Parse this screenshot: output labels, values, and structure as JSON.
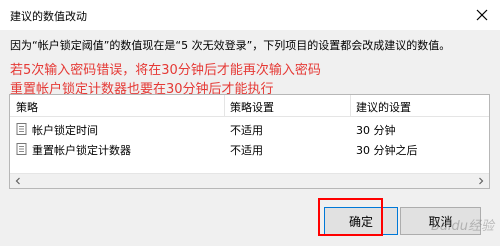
{
  "window": {
    "title": "建议的数值改动"
  },
  "message": "因为“帐户锁定阈值”的数值现在是“5 次无效登录”，下列项目的设置都会改成建议的数值。",
  "annotation": {
    "line1": "若5次输入密码错误，将在30分钟后才能再次输入密码",
    "line2": "重置帐户锁定计数器也要在30分钟后才能执行",
    "color": "#e53935"
  },
  "table": {
    "headers": [
      "策略",
      "策略设置",
      "建议的设置"
    ],
    "rows": [
      {
        "policy": "帐户锁定时间",
        "setting": "不适用",
        "suggested": "30 分钟"
      },
      {
        "policy": "重置帐户锁定计数器",
        "setting": "不适用",
        "suggested": "30 分钟之后"
      }
    ]
  },
  "buttons": {
    "ok": "确定",
    "cancel": "取消"
  },
  "watermark": "Baidu经验",
  "icons": {
    "close": "close-icon",
    "policy": "policy-icon"
  }
}
